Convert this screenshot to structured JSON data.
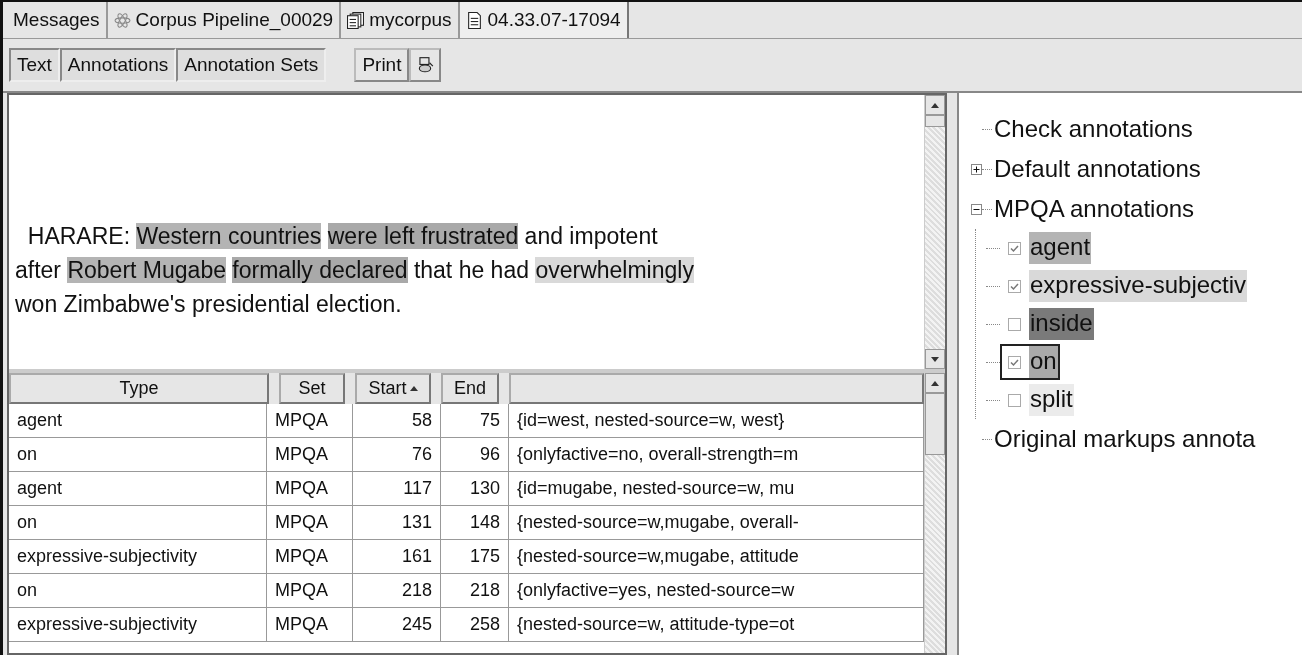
{
  "tabs": [
    {
      "label": "Messages",
      "kind": "messages",
      "selected": false
    },
    {
      "label": "Corpus Pipeline_00029",
      "kind": "pipeline",
      "selected": false
    },
    {
      "label": "mycorpus",
      "kind": "corpus",
      "selected": false
    },
    {
      "label": "04.33.07-17094",
      "kind": "document",
      "selected": true
    }
  ],
  "view_buttons": [
    {
      "label": "Text",
      "selected": true
    },
    {
      "label": "Annotations",
      "selected": true
    },
    {
      "label": "Annotation Sets",
      "selected": true
    }
  ],
  "print_button": "Print",
  "text_lines": [
    [
      {
        "text": "  HARARE:"
      },
      {
        "text": " Western countries",
        "color": "#b4b4b4"
      },
      {
        "text": " were left frustrated",
        "color": "#a9a9a9"
      },
      {
        "text": " and impotent"
      }
    ],
    [
      {
        "text": "after"
      },
      {
        "text": " Robert Mugabe",
        "color": "#b4b4b4"
      },
      {
        "text": " formally declared",
        "color": "#a9a9a9"
      },
      {
        "text": " that he had"
      },
      {
        "text": " overwhelmingly",
        "color": "#d9d9d9"
      }
    ],
    [
      {
        "text": "won Zimbabwe's presidential election."
      }
    ]
  ],
  "table": {
    "columns": [
      {
        "label": "Type",
        "sorted": false
      },
      {
        "label": "Set",
        "sorted": false
      },
      {
        "label": "Start",
        "sorted": true
      },
      {
        "label": "End",
        "sorted": false
      }
    ],
    "rows": [
      {
        "type": "agent",
        "set": "MPQA",
        "start": "58",
        "end": "75",
        "features": "{id=west, nested-source=w, west}"
      },
      {
        "type": "on",
        "set": "MPQA",
        "start": "76",
        "end": "96",
        "features": "{onlyfactive=no, overall-strength=m"
      },
      {
        "type": "agent",
        "set": "MPQA",
        "start": "117",
        "end": "130",
        "features": "{id=mugabe, nested-source=w, mu"
      },
      {
        "type": "on",
        "set": "MPQA",
        "start": "131",
        "end": "148",
        "features": "{nested-source=w,mugabe, overall-"
      },
      {
        "type": "expressive-subjectivity",
        "set": "MPQA",
        "start": "161",
        "end": "175",
        "features": "{nested-source=w,mugabe, attitude"
      },
      {
        "type": "on",
        "set": "MPQA",
        "start": "218",
        "end": "218",
        "features": "{onlyfactive=yes, nested-source=w"
      },
      {
        "type": "expressive-subjectivity",
        "set": "MPQA",
        "start": "245",
        "end": "258",
        "features": "{nested-source=w, attitude-type=ot"
      }
    ]
  },
  "tree": [
    {
      "label": "Check annotations"
    },
    {
      "label": "Default annotations",
      "expanded": false
    },
    {
      "label": "MPQA annotations",
      "expanded": true,
      "children": [
        {
          "label": "agent",
          "checked": true,
          "color": "#b4b4b4",
          "selected": false
        },
        {
          "label": "expressive-subjectiv",
          "checked": true,
          "color": "#d9d9d9",
          "selected": false
        },
        {
          "label": "inside",
          "checked": false,
          "color": "#7a7a7a",
          "selected": false
        },
        {
          "label": "on",
          "checked": true,
          "color": "#a9a9a9",
          "selected": true
        },
        {
          "label": "split",
          "checked": false,
          "color": "#ebebeb",
          "selected": false
        }
      ]
    },
    {
      "label": "Original markups annota"
    }
  ]
}
